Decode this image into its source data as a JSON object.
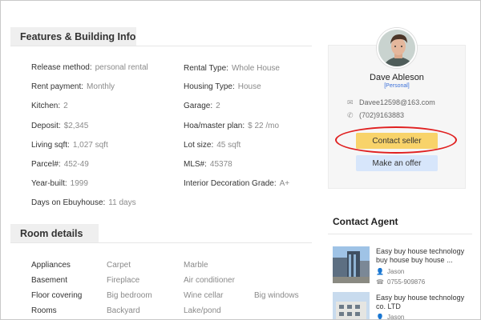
{
  "features": {
    "title": "Features & Building Info",
    "left": [
      {
        "label": "Release method:",
        "value": "personal rental"
      },
      {
        "label": "Rent payment:",
        "value": "Monthly"
      },
      {
        "label": "Kitchen:",
        "value": "2"
      },
      {
        "label": "Deposit:",
        "value": "$2,345"
      },
      {
        "label": "Living sqft:",
        "value": "1,027 sqft"
      },
      {
        "label": "Parcel#:",
        "value": "452-49"
      },
      {
        "label": "Year-built:",
        "value": "1999"
      },
      {
        "label": "Days on Ebuyhouse:",
        "value": "11 days"
      }
    ],
    "right": [
      {
        "label": "Rental Type:",
        "value": "Whole House"
      },
      {
        "label": "Housing Type:",
        "value": "House"
      },
      {
        "label": "Garage:",
        "value": "2"
      },
      {
        "label": "Hoa/master plan:",
        "value": "$ 22 /mo"
      },
      {
        "label": "Lot size:",
        "value": "45 sqft"
      },
      {
        "label": "MLS#:",
        "value": "45378"
      },
      {
        "label": "Interior Decoration Grade:",
        "value": "A+"
      }
    ]
  },
  "rooms": {
    "title": "Room details",
    "rows": [
      {
        "label": "Appliances",
        "items": [
          "Carpet",
          "Marble"
        ]
      },
      {
        "label": "Basement",
        "items": [
          "Fireplace",
          "Air conditioner"
        ]
      },
      {
        "label": "Floor covering",
        "items": [
          "Big bedroom",
          "Wine cellar",
          "Big windows"
        ]
      },
      {
        "label": "Rooms",
        "items": [
          "Backyard",
          "Lake/pond"
        ]
      }
    ]
  },
  "seller": {
    "name": "Dave Ableson",
    "tag": "[Personal]",
    "email": "Davee12598@163.com",
    "phone": "(702)9163883",
    "contact_label": "Contact seller",
    "offer_label": "Make an offer"
  },
  "agents": {
    "title": "Contact Agent",
    "items": [
      {
        "title": "Easy buy house technology buy house  buy house ...",
        "name": "Jason",
        "phone": "0755-909876"
      },
      {
        "title": "Easy buy house technology co. LTD",
        "name": "Jason",
        "phone": ""
      }
    ]
  },
  "colors": {
    "contact_button": "#f8d36a",
    "offer_button": "#d7e6fb",
    "highlight_ring": "#e02020",
    "seller_tag": "#3a6fd8"
  }
}
